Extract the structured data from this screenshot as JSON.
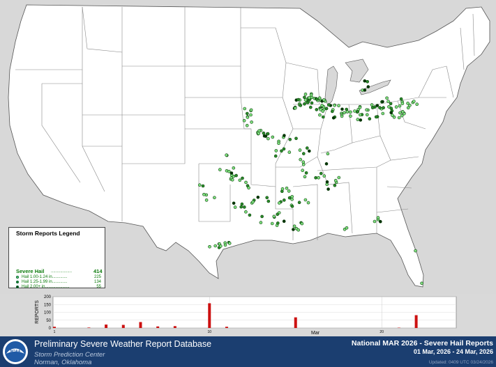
{
  "legend": {
    "title": "Storm Reports Legend",
    "category_label": "Severe Hail",
    "leader_dots": "..................",
    "total": "414",
    "rows": [
      {
        "label": "Hail 1.00-1.24 in.............",
        "count": "225",
        "fill": "#7fe07f"
      },
      {
        "label": "Hail 1.25-1.99 in.............",
        "count": "134",
        "fill": "#2a8c2a"
      },
      {
        "label": "Hail 2.00+ in.....................",
        "count": "55",
        "fill": "#003300"
      }
    ]
  },
  "chart": {
    "y_axis_title": "REPORTS",
    "y_ticks": [
      "200",
      "150",
      "100",
      "50",
      "0"
    ],
    "x_tick_labels": [
      "1",
      "10",
      "20"
    ],
    "month_label": "Mar"
  },
  "chart_data": {
    "type": "bar",
    "x": [
      1,
      3,
      4,
      5,
      6,
      7,
      8,
      10,
      11,
      15,
      21,
      22
    ],
    "values": [
      8,
      3,
      22,
      20,
      38,
      10,
      12,
      158,
      8,
      68,
      2,
      82
    ],
    "ylim": [
      0,
      200
    ],
    "xlim": [
      1,
      24
    ],
    "ylabel": "REPORTS",
    "xlabel": "Mar",
    "grid": true,
    "bar_color": "#cc1111"
  },
  "footer": {
    "db_title": "Preliminary Severe Weather Report Database",
    "center_name": "Storm Prediction Center",
    "location": "Norman, Oklahoma",
    "report_title": "National MAR 2026 - Severe Hail Reports",
    "date_range": "01 Mar, 2026 - 24 Mar, 2026",
    "updated": "Updated: 0409 UTC 03/24/2026",
    "logo_text": "NOAA"
  },
  "colors": {
    "land": "#ffffff",
    "background": "#d8d8d8",
    "footer": "#1b3e70",
    "hail_small": "#7fe07f",
    "hail_medium": "#2a8c2a",
    "hail_large": "#003300"
  }
}
